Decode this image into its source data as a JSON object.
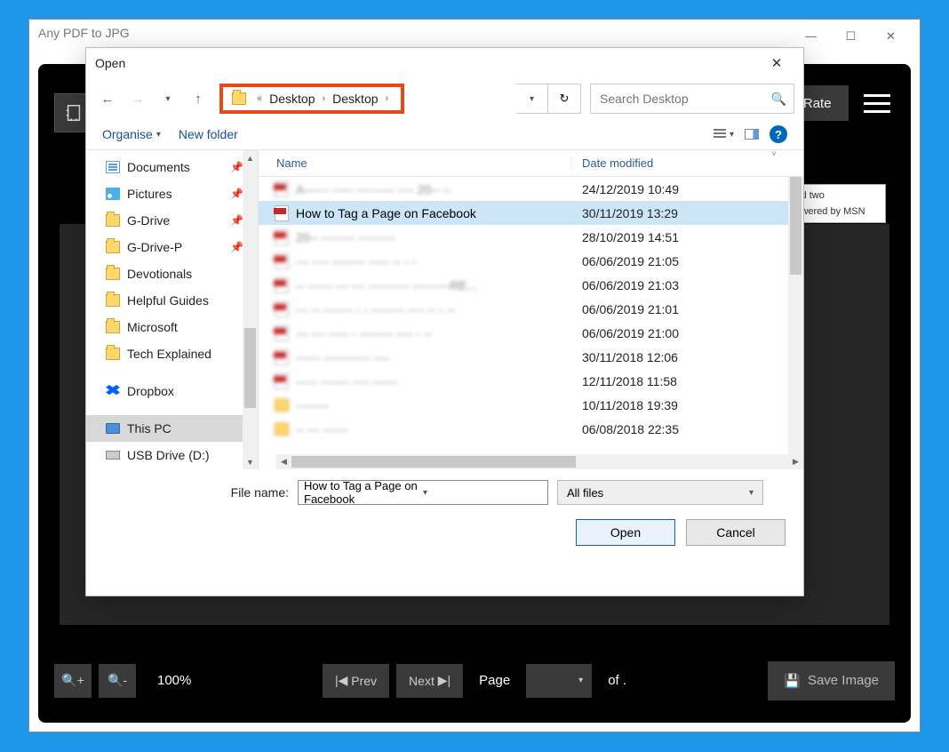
{
  "parent": {
    "title": "Any PDF to JPG",
    "rate_label": "Rate",
    "msn_top": "dopted two",
    "msn_bottom": "Powered by MSN",
    "footer": {
      "zoom": "100%",
      "prev": "Prev",
      "next": "Next",
      "page_label": "Page",
      "of_label": "of .",
      "save": "Save Image"
    }
  },
  "dialog": {
    "title": "Open",
    "breadcrumb": [
      "Desktop",
      "Desktop"
    ],
    "search_placeholder": "Search Desktop",
    "toolbar": {
      "organise": "Organise",
      "new_folder": "New folder"
    },
    "sidebar": [
      {
        "label": "Documents",
        "icon": "doc",
        "pinned": true
      },
      {
        "label": "Pictures",
        "icon": "pic",
        "pinned": true
      },
      {
        "label": "G-Drive",
        "icon": "folder",
        "pinned": true
      },
      {
        "label": "G-Drive-P",
        "icon": "folder",
        "pinned": true
      },
      {
        "label": "Devotionals",
        "icon": "folder",
        "pinned": false
      },
      {
        "label": "Helpful Guides",
        "icon": "folder",
        "pinned": false
      },
      {
        "label": "Microsoft",
        "icon": "folder",
        "pinned": false
      },
      {
        "label": "Tech Explained",
        "icon": "folder",
        "pinned": false
      },
      {
        "label": "Dropbox",
        "icon": "dropbox",
        "pinned": false,
        "spacer": true
      },
      {
        "label": "This PC",
        "icon": "pc",
        "pinned": false,
        "selected": true,
        "spacer": true
      },
      {
        "label": "USB Drive (D:)",
        "icon": "usb",
        "pinned": false
      }
    ],
    "columns": {
      "name": "Name",
      "date": "Date modified"
    },
    "files": [
      {
        "name": "A------ ----- --------- ---- 20-- --",
        "date": "24/12/2019 10:49",
        "icon": "pdf",
        "blur": true
      },
      {
        "name": "How to Tag a Page on Facebook",
        "date": "30/11/2019 13:29",
        "icon": "pdf",
        "selected": true
      },
      {
        "name": "20-- -------- ---------",
        "date": "28/10/2019 14:51",
        "icon": "pdf",
        "blur": true
      },
      {
        "name": "--- ---- -------- ----- -- - -",
        "date": "06/06/2019 21:05",
        "icon": "pdf",
        "blur": true
      },
      {
        "name": "-- ------ --- --- ---------- ---------RE...",
        "date": "06/06/2019 21:03",
        "icon": "pdf",
        "blur": true
      },
      {
        "name": "--- -- ------- - - -------- ---- -- - --",
        "date": "06/06/2019 21:01",
        "icon": "pdf",
        "blur": true
      },
      {
        "name": "--- --- ----- - -------- ---- - --",
        "date": "06/06/2019 21:00",
        "icon": "pdf",
        "blur": true
      },
      {
        "name": "------ ----------- ----",
        "date": "30/11/2018 12:06",
        "icon": "pdf",
        "blur": true
      },
      {
        "name": "----- ------- ---- ------",
        "date": "12/11/2018 11:58",
        "icon": "pdf",
        "blur": true
      },
      {
        "name": "--------",
        "date": "10/11/2018 19:39",
        "icon": "folder",
        "blur": true
      },
      {
        "name": "-- --- ------",
        "date": "06/08/2018 22:35",
        "icon": "folder",
        "blur": true
      }
    ],
    "file_name_label": "File name:",
    "file_name_value": "How to Tag a Page on Facebook",
    "filter_value": "All files",
    "open_label": "Open",
    "cancel_label": "Cancel"
  }
}
